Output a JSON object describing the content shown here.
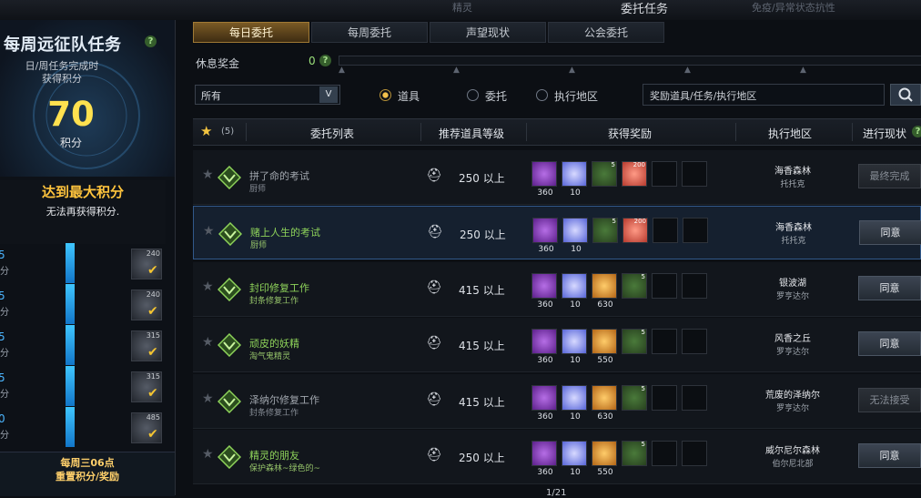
{
  "top_tabs": [
    "精灵",
    "委托任务",
    "免疫/异常状态抗性"
  ],
  "weekly": {
    "title": "每周远征队任务",
    "subtitle": "日/周任务完成时\n获得积分",
    "score": "70",
    "score_unit": "积分",
    "max_title": "达到最大积分",
    "max_sub": "无法再获得积分.",
    "reset": "每周三06点\n重置积分/奖励",
    "tiers": [
      {
        "num": "5",
        "unit": "分",
        "reward": "240"
      },
      {
        "num": "5",
        "unit": "分",
        "reward": "240"
      },
      {
        "num": "5",
        "unit": "分",
        "reward": "315"
      },
      {
        "num": "5",
        "unit": "分",
        "reward": "315"
      },
      {
        "num": "0",
        "unit": "分",
        "reward": "485"
      }
    ]
  },
  "tabs": [
    "每日委托",
    "每周委托",
    "声望现状",
    "公会委托"
  ],
  "rest_bonus": {
    "label": "休息奖金",
    "value": "0"
  },
  "filter": {
    "selected": "所有",
    "dropdown_icon": "V",
    "radios": [
      "道具",
      "委托",
      "执行地区"
    ],
    "radio_selected": 0,
    "search_placeholder": "奖励道具/任务/执行地区"
  },
  "table_header": {
    "fav_count": "(5)",
    "cols": [
      "委托列表",
      "推荐道具等级",
      "获得奖励",
      "执行地区",
      "进行现状"
    ]
  },
  "rows": [
    {
      "name": "拼了命的考试",
      "sub": "厨师",
      "level": "250 以上",
      "zone": "海香森林",
      "zone_sub": "托托克",
      "status": "最终完成",
      "status_enabled": false,
      "dim": true,
      "rewards": [
        {
          "kind": "purple",
          "count": "360"
        },
        {
          "kind": "crystal",
          "count": "10"
        },
        {
          "kind": "potion",
          "count": "",
          "sup": "5"
        },
        {
          "kind": "heart",
          "count": "",
          "sup": "200"
        }
      ]
    },
    {
      "name": "赌上人生的考试",
      "sub": "厨师",
      "level": "250 以上",
      "zone": "海香森林",
      "zone_sub": "托托克",
      "status": "同意",
      "status_enabled": true,
      "dim": false,
      "rewards": [
        {
          "kind": "purple",
          "count": "360"
        },
        {
          "kind": "crystal",
          "count": "10"
        },
        {
          "kind": "potion",
          "count": "",
          "sup": "5"
        },
        {
          "kind": "heart",
          "count": "",
          "sup": "200"
        }
      ]
    },
    {
      "name": "封印修复工作",
      "sub": "封条修复工作",
      "level": "415 以上",
      "zone": "银波湖",
      "zone_sub": "罗亨达尔",
      "status": "同意",
      "status_enabled": true,
      "dim": false,
      "rewards": [
        {
          "kind": "purple",
          "count": "360"
        },
        {
          "kind": "crystal",
          "count": "10"
        },
        {
          "kind": "lantern",
          "count": "630"
        },
        {
          "kind": "potion",
          "count": "",
          "sup": "5"
        }
      ]
    },
    {
      "name": "顽皮的妖精",
      "sub": "淘气鬼精灵",
      "level": "415 以上",
      "zone": "风香之丘",
      "zone_sub": "罗亨达尔",
      "status": "同意",
      "status_enabled": true,
      "dim": false,
      "rewards": [
        {
          "kind": "purple",
          "count": "360"
        },
        {
          "kind": "crystal",
          "count": "10"
        },
        {
          "kind": "lantern",
          "count": "550"
        },
        {
          "kind": "potion",
          "count": "",
          "sup": "5"
        }
      ]
    },
    {
      "name": "泽纳尔修复工作",
      "sub": "封条修复工作",
      "level": "415 以上",
      "zone": "荒废的泽纳尔",
      "zone_sub": "罗亨达尔",
      "status": "无法接受",
      "status_enabled": false,
      "dim": true,
      "rewards": [
        {
          "kind": "purple",
          "count": "360"
        },
        {
          "kind": "crystal",
          "count": "10"
        },
        {
          "kind": "lantern",
          "count": "630"
        },
        {
          "kind": "potion",
          "count": "",
          "sup": "5"
        }
      ]
    },
    {
      "name": "精灵的朋友",
      "sub": "保护森林~绿色的~",
      "level": "250 以上",
      "zone": "威尔尼尔森林",
      "zone_sub": "伯尔尼北部",
      "status": "同意",
      "status_enabled": true,
      "dim": false,
      "rewards": [
        {
          "kind": "purple",
          "count": "360"
        },
        {
          "kind": "crystal",
          "count": "10"
        },
        {
          "kind": "lantern",
          "count": "550"
        },
        {
          "kind": "potion",
          "count": "",
          "sup": "5"
        }
      ]
    }
  ],
  "pager": "1/21"
}
